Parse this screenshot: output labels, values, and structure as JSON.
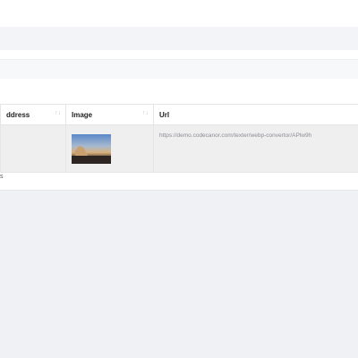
{
  "table": {
    "headers": [
      {
        "label": "ddress",
        "sort_icon": "↑↓"
      },
      {
        "label": "Image",
        "sort_icon": "↑↓"
      },
      {
        "label": "Url",
        "sort_icon": ""
      }
    ],
    "rows": [
      {
        "address": "",
        "image_icon": "landscape-thumbnail",
        "url": "https://demo.codecanor.com/texter/webp-convertor/APlw9h"
      }
    ]
  },
  "footer": {
    "text": "s"
  }
}
